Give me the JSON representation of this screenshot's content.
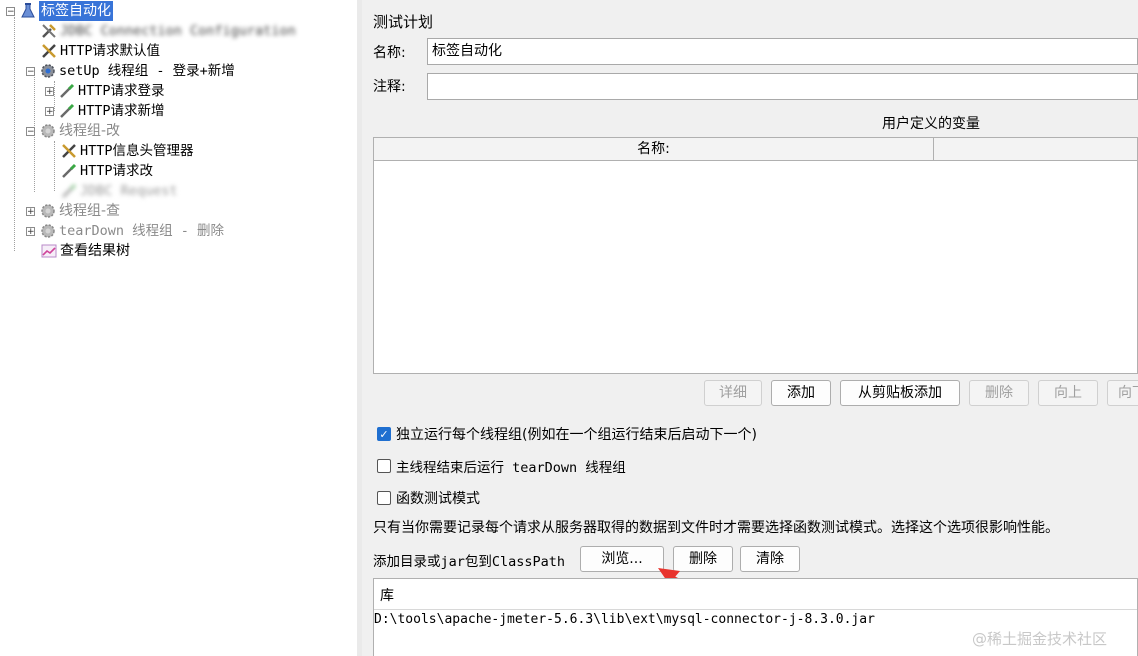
{
  "tree": {
    "items": [
      {
        "label": "标签自动化",
        "icon": "test-plan-flask-icon",
        "selected": true
      },
      {
        "label": "JDBC Connection Configuration",
        "icon": "wrench-icon",
        "blurred": true
      },
      {
        "label": "HTTP请求默认值",
        "icon": "wrench-icon"
      },
      {
        "label": "setUp 线程组 - 登录+新增",
        "icon": "gear-icon"
      },
      {
        "label": "HTTP请求登录",
        "icon": "pipette-sampler-icon"
      },
      {
        "label": "HTTP请求新增",
        "icon": "pipette-sampler-icon"
      },
      {
        "label": "线程组-改",
        "icon": "gear-icon"
      },
      {
        "label": "HTTP信息头管理器",
        "icon": "wrench-icon"
      },
      {
        "label": "HTTP请求改",
        "icon": "pipette-sampler-icon"
      },
      {
        "label": "JDBC Request",
        "icon": "pipette-sampler-icon",
        "blurred": true
      },
      {
        "label": "线程组-查",
        "icon": "gear-icon"
      },
      {
        "label": "tearDown 线程组 - 删除",
        "icon": "gear-icon"
      },
      {
        "label": "查看结果树",
        "icon": "result-tree-chart-icon"
      }
    ]
  },
  "panel": {
    "title": "测试计划",
    "name_label": "名称:",
    "name_value": "标签自动化",
    "comment_label": "注释:",
    "comment_value": "",
    "variables": {
      "title": "用户定义的变量",
      "columns": [
        "名称:",
        ""
      ]
    },
    "buttons": {
      "detail": "详细",
      "add": "添加",
      "add_clipboard": "从剪贴板添加",
      "delete": "删除",
      "up": "向上",
      "down": "向下"
    },
    "checkboxes": {
      "run_independently": {
        "label": "独立运行每个线程组(例如在一个组运行结束后启动下一个)",
        "checked": true
      },
      "teardown_after_shutdown": {
        "label": "主线程结束后运行 tearDown 线程组",
        "checked": false
      },
      "functional_mode": {
        "label": "函数测试模式",
        "checked": false
      }
    },
    "functional_note": "只有当你需要记录每个请求从服务器取得的数据到文件时才需要选择函数测试模式。选择这个选项很影响性能。",
    "classpath": {
      "label": "添加目录或jar包到ClassPath",
      "browse": "浏览...",
      "delete": "删除",
      "clear": "清除",
      "table_header": "库",
      "entries": [
        "D:\\tools\\apache-jmeter-5.6.3\\lib\\ext\\mysql-connector-j-8.3.0.jar"
      ]
    }
  },
  "watermark": "@稀土掘金技术社区",
  "colors": {
    "selection": "#3874d8",
    "arrow": "#e8342e",
    "checkbox_checked": "#1f6fd0"
  }
}
